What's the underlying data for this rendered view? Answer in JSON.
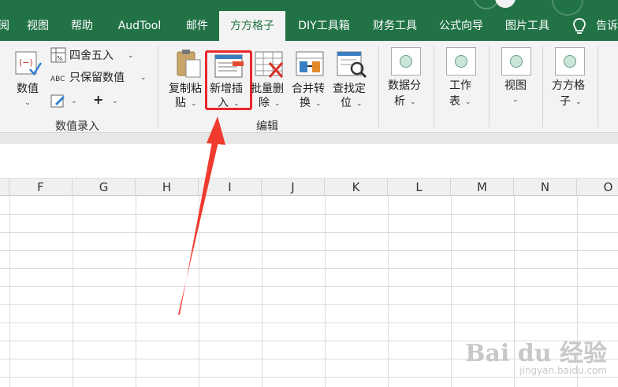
{
  "tabs": [
    {
      "key": "partial-left",
      "label": "阅"
    },
    {
      "key": "view",
      "label": "视图"
    },
    {
      "key": "help",
      "label": "帮助"
    },
    {
      "key": "audtool",
      "label": "AudTool"
    },
    {
      "key": "mail",
      "label": "邮件"
    },
    {
      "key": "fangfang",
      "label": "方方格子"
    },
    {
      "key": "diy",
      "label": "DIY工具箱"
    },
    {
      "key": "finance",
      "label": "财务工具"
    },
    {
      "key": "formula",
      "label": "公式向导"
    },
    {
      "key": "image",
      "label": "图片工具"
    },
    {
      "key": "tell",
      "label": "告诉"
    }
  ],
  "ribbon": {
    "numeric": {
      "value_btn": {
        "line1": "数值",
        "caret": "⌄"
      },
      "round_btn": {
        "label": "四舍五入",
        "caret": "⌄"
      },
      "keep_value_btn": {
        "label": "只保留数值",
        "caret": "⌄"
      },
      "abc_icon_text": "ABC",
      "edit_btn_caret": "⌄",
      "plus_btn": {
        "label": "+",
        "caret": "⌄"
      },
      "group_label": "数值录入"
    },
    "edit": {
      "copy_paste": {
        "line1": "复制粘",
        "line2": "贴",
        "caret": "⌄"
      },
      "new_insert": {
        "line1": "新增插",
        "line2": "入",
        "caret": "⌄"
      },
      "batch_delete": {
        "line1": "批量删",
        "line2": "除",
        "caret": "⌄"
      },
      "merge_convert": {
        "line1": "合并转",
        "line2": "换",
        "caret": "⌄"
      },
      "find_locate": {
        "line1": "查找定",
        "line2": "位",
        "caret": "⌄"
      },
      "group_label": "编辑"
    },
    "data_analysis": {
      "line1": "数据分",
      "line2": "析",
      "caret": "⌄"
    },
    "worksheet": {
      "line1": "工作",
      "line2": "表",
      "caret": "⌄"
    },
    "view": {
      "line1": "视图",
      "caret": "⌄"
    },
    "fangfang": {
      "line1": "方方格",
      "line2": "子",
      "caret": "⌄"
    }
  },
  "columns": [
    "F",
    "G",
    "H",
    "I",
    "J",
    "K",
    "L",
    "M",
    "N",
    "O"
  ],
  "watermark": {
    "main": "Bai du 经验",
    "sub": "jingyan.baidu.com"
  },
  "colors": {
    "ribbon_green": "#217346",
    "highlight_red": "#e8272a",
    "arrow_red": "#f03a2e"
  }
}
